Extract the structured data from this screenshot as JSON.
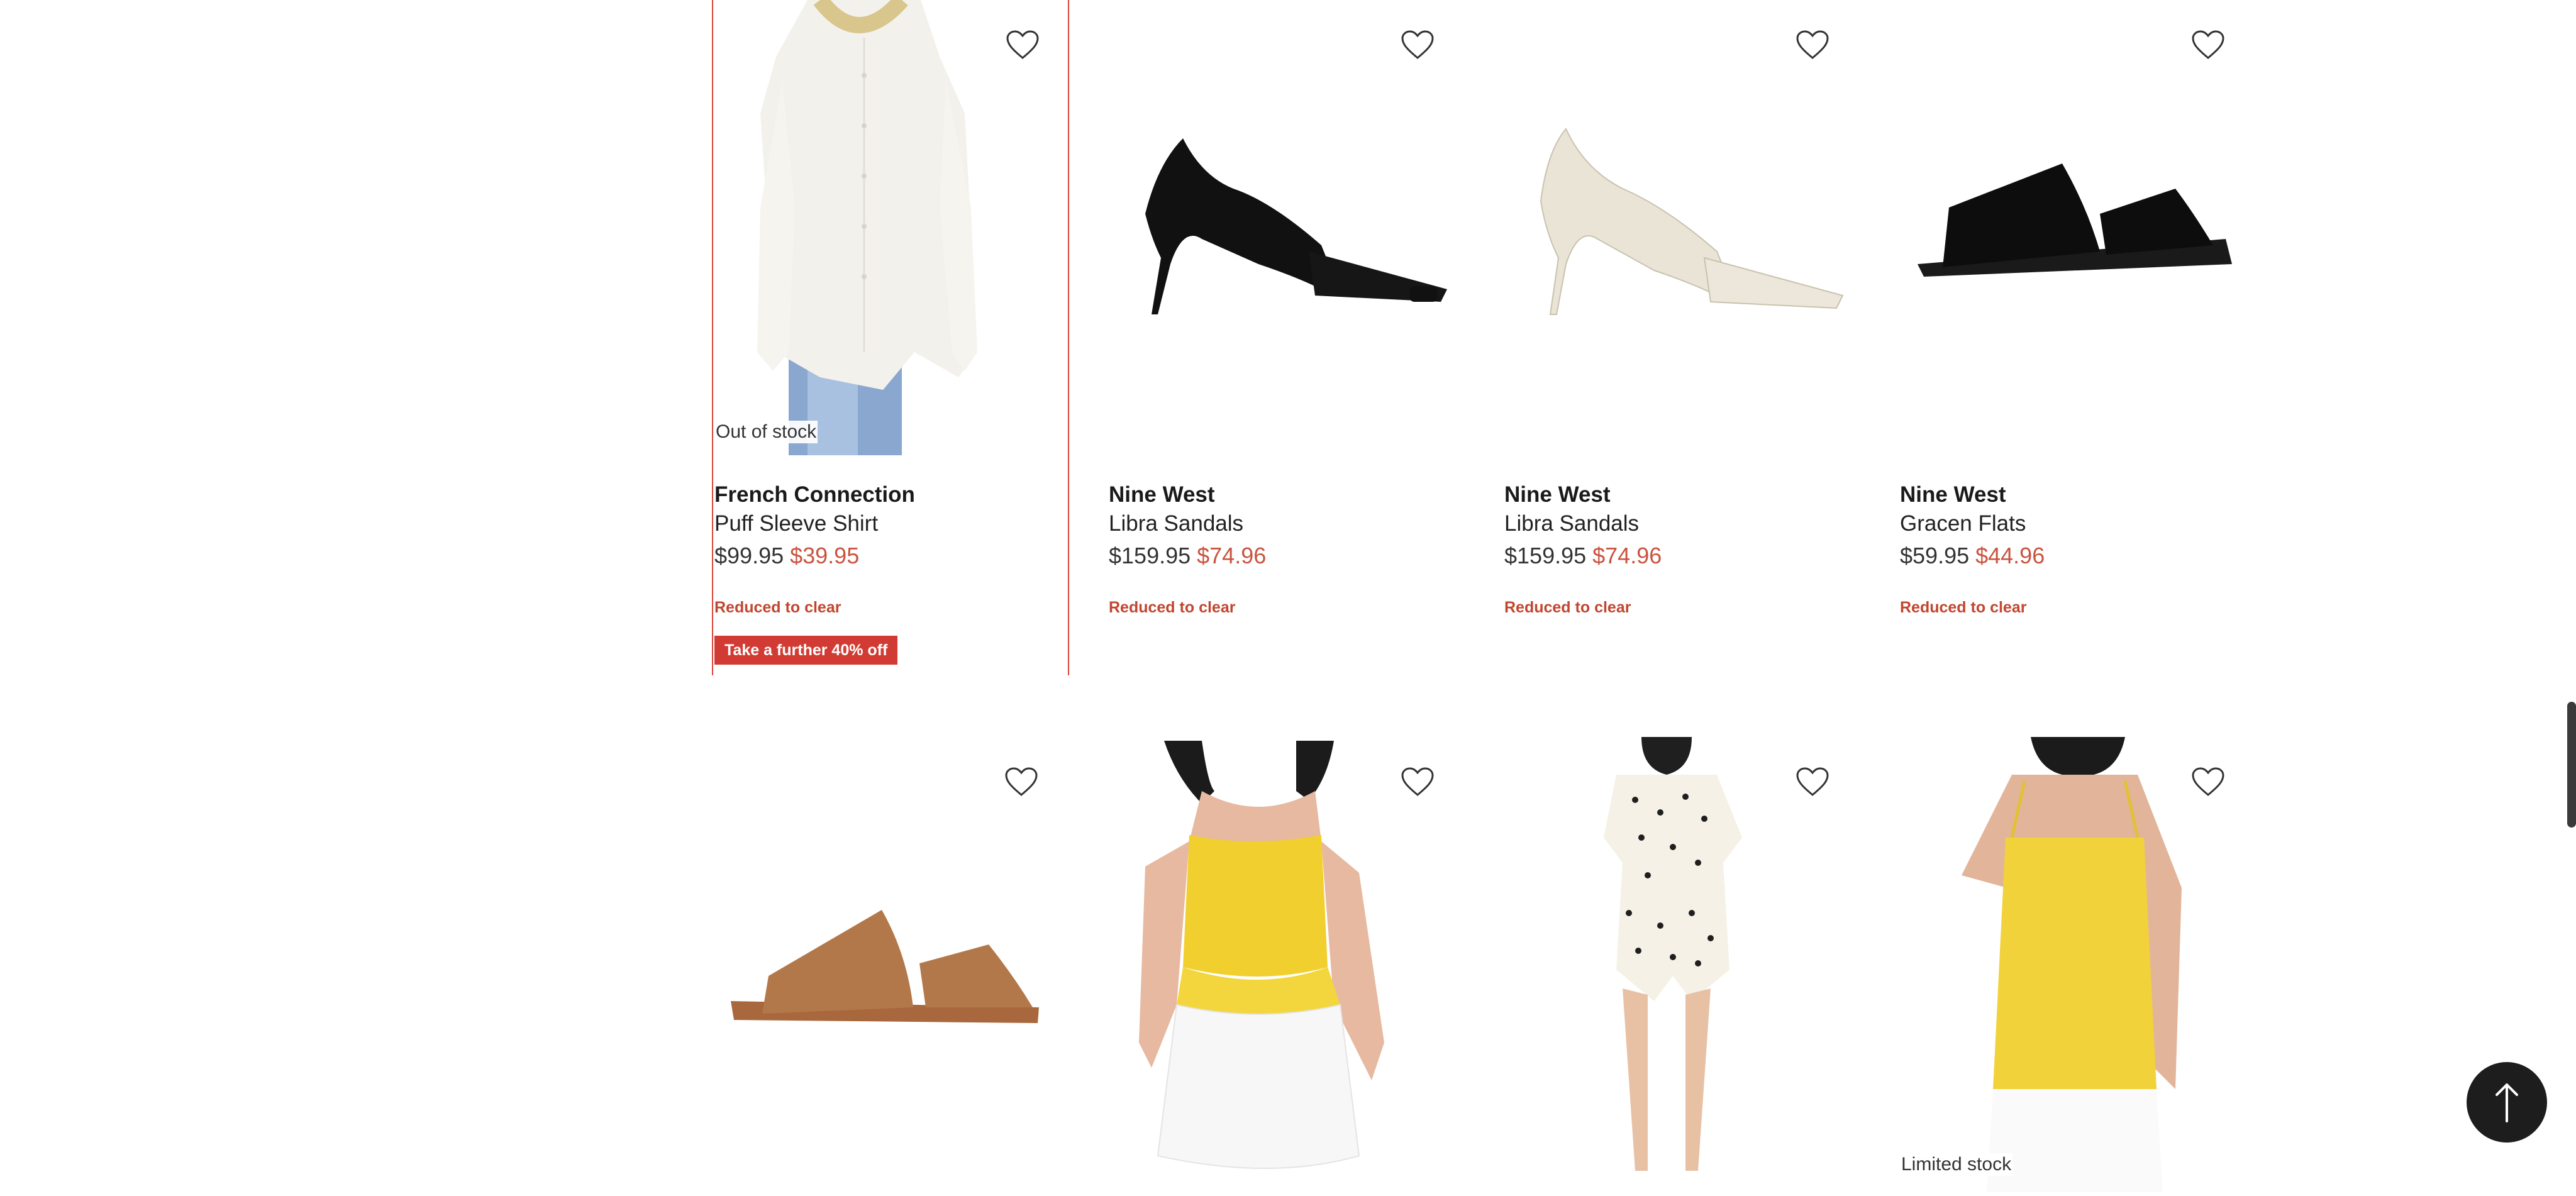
{
  "products": [
    {
      "brand": "French Connection",
      "name": "Puff Sleeve Shirt",
      "price_was": "$99.95",
      "price_now": "$39.95",
      "badge": "Reduced to clear",
      "stock": "Out of stock",
      "promo": "Take a further 40% off"
    },
    {
      "brand": "Nine West",
      "name": "Libra Sandals",
      "price_was": "$159.95",
      "price_now": "$74.96",
      "badge": "Reduced to clear"
    },
    {
      "brand": "Nine West",
      "name": "Libra Sandals",
      "price_was": "$159.95",
      "price_now": "$74.96",
      "badge": "Reduced to clear"
    },
    {
      "brand": "Nine West",
      "name": "Gracen Flats",
      "price_was": "$59.95",
      "price_now": "$44.96",
      "badge": "Reduced to clear"
    },
    {},
    {},
    {},
    {
      "stock": "Limited stock"
    }
  ],
  "icons": {
    "wishlist": "heart-outline-icon",
    "back_to_top": "arrow-up-icon"
  },
  "colors": {
    "sale_red": "#c9533f",
    "promo_bg": "#d23b33",
    "selection": "#d7463a"
  }
}
